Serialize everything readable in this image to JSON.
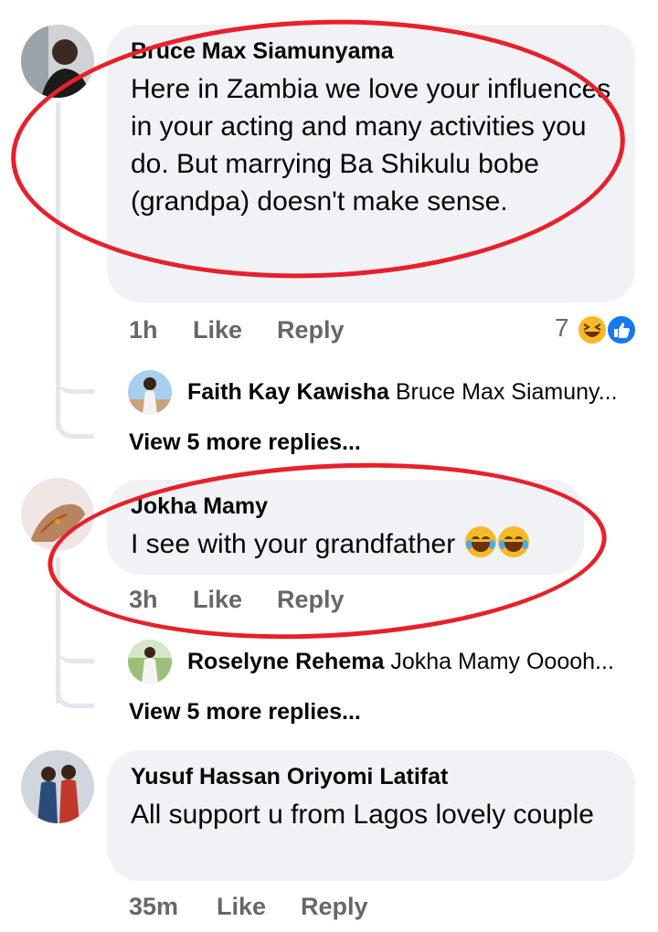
{
  "comments": [
    {
      "author": "Bruce Max Siamunyama",
      "text": "Here in Zambia we love your influences in your acting and many activities you do. But marrying Ba Shikulu bobe  (grandpa)  doesn't make sense.",
      "time": "1h",
      "like_label": "Like",
      "reply_label": "Reply",
      "reaction_count": "7",
      "reactions": [
        "haha-icon",
        "like-icon"
      ],
      "reply_preview": {
        "author": "Faith Kay Kawisha",
        "snippet": "Bruce Max Siamuny..."
      },
      "view_more": "View 5 more replies..."
    },
    {
      "author": "Jokha Mamy",
      "text": "I see with your grandfather",
      "emojis": [
        "tears-of-joy-emoji",
        "tears-of-joy-emoji"
      ],
      "time": "3h",
      "like_label": "Like",
      "reply_label": "Reply",
      "reply_preview": {
        "author": "Roselyne Rehema",
        "snippet": "Jokha Mamy Ooooh..."
      },
      "view_more": "View 5 more replies..."
    },
    {
      "author": "Yusuf Hassan Oriyomi Latifat",
      "text": "All support u from Lagos lovely couple",
      "time": "35m",
      "like_label": "Like",
      "reply_label": "Reply"
    }
  ],
  "colors": {
    "bubble": "#f0f2f5",
    "meta": "#65676b",
    "annotation": "#e8202a",
    "like_blue": "#1877f2",
    "haha_yellow": "#f7b928"
  }
}
